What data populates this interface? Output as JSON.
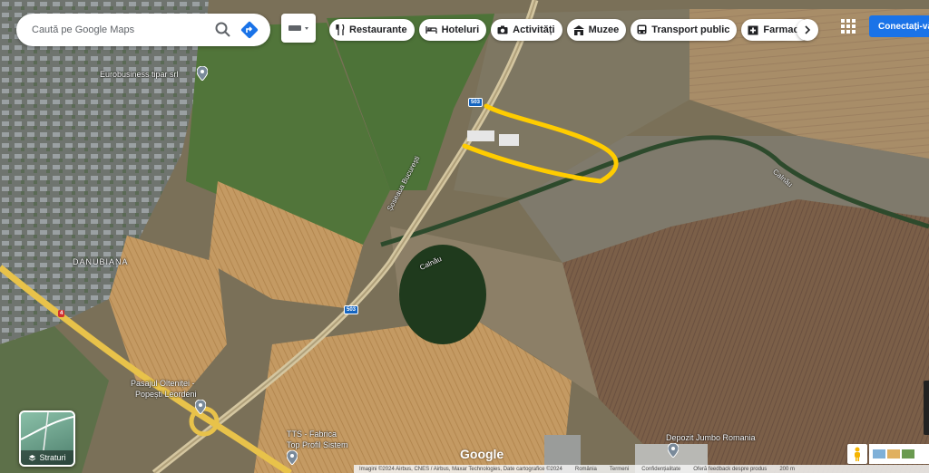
{
  "search": {
    "placeholder": "Caută pe Google Maps"
  },
  "categories": [
    {
      "label": "Restaurante",
      "icon": "fork-knife-icon"
    },
    {
      "label": "Hoteluri",
      "icon": "bed-icon"
    },
    {
      "label": "Activități",
      "icon": "camera-icon"
    },
    {
      "label": "Muzee",
      "icon": "museum-icon"
    },
    {
      "label": "Transport public",
      "icon": "bus-icon"
    },
    {
      "label": "Farmacii",
      "icon": "pharmacy-icon"
    }
  ],
  "header": {
    "sign_in": "Conectați-vă"
  },
  "layers": {
    "label": "Straturi"
  },
  "map_labels": {
    "eurobusiness": "Eurobusiness tipar srl",
    "danubiana": "DANUBIANA",
    "soseaua": "Șoseaua București",
    "calnau_1": "Calnău",
    "calnau_2": "Calnău",
    "pasajul_1": "Pasajul Olteniței -",
    "pasajul_2": "Popești Leordeni",
    "tts_1": "TTS - Fabrica",
    "tts_2": "Top Profil Sistem",
    "depozit": "Depozit Jumbo Romania",
    "route_1": "503",
    "route_2": "503",
    "route_e": "4"
  },
  "google_logo": "Google",
  "attribution": {
    "imagery": "Imagini ©2024 Airbus, CNES / Airbus, Maxar Technologies, Date cartografice ©2024",
    "terms": "România",
    "privacy": "Termeni",
    "feedback": "Confidențialitate",
    "report": "Oferă feedback despre produs",
    "scale": "200 m"
  },
  "colors": {
    "annotation": "#ffcc00",
    "accent": "#1a73e8",
    "road": "#e8c24a"
  }
}
